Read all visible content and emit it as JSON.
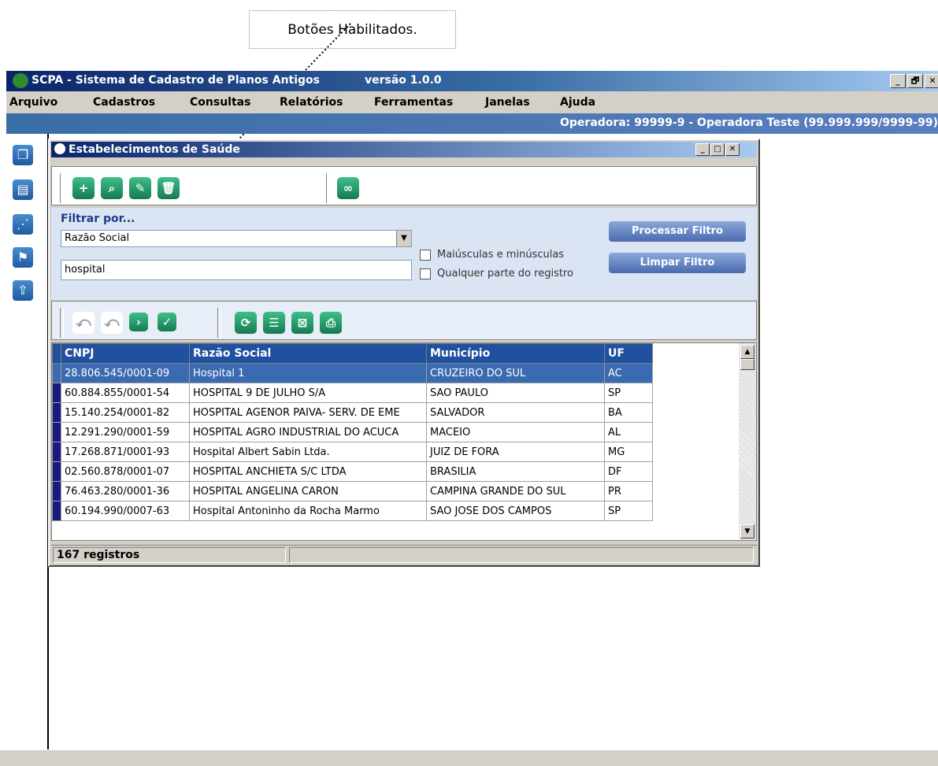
{
  "callout": {
    "text": "Botões Habilitados."
  },
  "window": {
    "title": "SCPA - Sistema de Cadastro de Planos Antigos",
    "version": "versão 1.0.0",
    "buttons": {
      "minimize": "_",
      "maximize": "🗗",
      "close": "✕"
    }
  },
  "menu": {
    "items": [
      {
        "label": "Arquivo"
      },
      {
        "label": "Cadastros"
      },
      {
        "label": "Consultas"
      },
      {
        "label": "Relatórios"
      },
      {
        "label": "Ferramentas"
      },
      {
        "label": "Janelas"
      },
      {
        "label": "Ajuda"
      }
    ]
  },
  "operator": {
    "text": "Operadora: 99999-9 - Operadora Teste (99.999.999/9999-99)"
  },
  "child": {
    "title": "Estabelecimentos de Saúde",
    "filter": {
      "label": "Filtrar por...",
      "selected": "Razão Social",
      "value": "hospital",
      "case_label": "Maiúsculas e minúsculas",
      "anypart_label": "Qualquer parte do registro",
      "process_button": "Processar Filtro",
      "clear_button": "Limpar Filtro"
    },
    "grid": {
      "columns": [
        "CNPJ",
        "Razão Social",
        "Município",
        "UF"
      ],
      "rows": [
        [
          "28.806.545/0001-09",
          "Hospital 1",
          "CRUZEIRO DO SUL",
          "AC"
        ],
        [
          "60.884.855/0001-54",
          "HOSPITAL 9 DE JULHO S/A",
          "SAO PAULO",
          "SP"
        ],
        [
          "15.140.254/0001-82",
          "HOSPITAL AGENOR PAIVA- SERV. DE EME",
          "SALVADOR",
          "BA"
        ],
        [
          "12.291.290/0001-59",
          "HOSPITAL AGRO INDUSTRIAL DO ACUCA",
          "MACEIO",
          "AL"
        ],
        [
          "17.268.871/0001-93",
          "Hospital Albert Sabin Ltda.",
          "JUIZ DE FORA",
          "MG"
        ],
        [
          "02.560.878/0001-07",
          "HOSPITAL ANCHIETA S/C LTDA",
          "BRASILIA",
          "DF"
        ],
        [
          "76.463.280/0001-36",
          "HOSPITAL ANGELINA CARON",
          "CAMPINA GRANDE DO SUL",
          "PR"
        ],
        [
          "60.194.990/0007-63",
          "Hospital Antoninho da Rocha Marmo",
          "SAO JOSE DOS CAMPOS",
          "SP"
        ]
      ]
    },
    "status": {
      "count": "167 registros"
    }
  },
  "colors": {
    "title_start": "#0a246a",
    "title_end": "#a6caf0",
    "icon_green": "#1f9a6a",
    "header_blue": "#2050a0"
  }
}
